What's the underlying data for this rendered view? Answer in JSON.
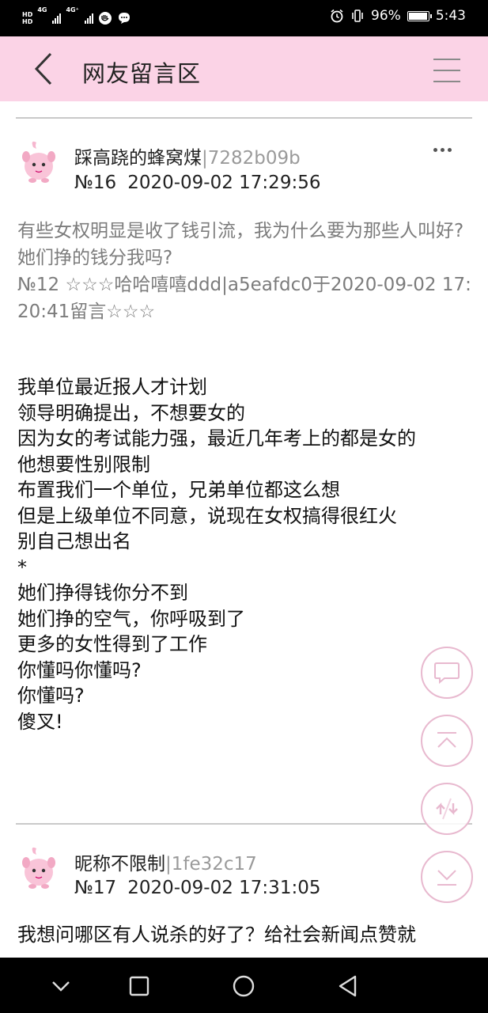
{
  "status_bar": {
    "hd1": "HD",
    "hd2": "HD",
    "network1": "4G",
    "network2": "4G⁺",
    "battery_percent": "96%",
    "battery_level": 0.96,
    "time": "5:43"
  },
  "header": {
    "title": "网友留言区"
  },
  "posts": [
    {
      "author": "踩高跷的蜂窝煤",
      "uid": "|7282b09b",
      "number": "№16",
      "datetime": "2020-09-02 17:29:56",
      "quote_text": "有些女权明显是收了钱引流，我为什么要为那些人叫好?她们挣的钱分我吗?",
      "quote_meta": "№12 ☆☆☆哈哈嘻嘻ddd|a5eafdc0于2020-09-02 17:20:41留言☆☆☆",
      "lines": [
        "我单位最近报人才计划",
        "领导明确提出，不想要女的",
        "因为女的考试能力强，最近几年考上的都是女的",
        "他想要性别限制",
        "布置我们一个单位，兄弟单位都这么想",
        "但是上级单位不同意，说现在女权搞得很红火",
        "别自己想出名",
        "*",
        "她们挣得钱你分不到",
        "她们挣的空气，你呼吸到了",
        "更多的女性得到了工作",
        "你懂吗你懂吗?",
        "你懂吗?",
        "傻叉!"
      ]
    },
    {
      "author": "昵称不限制",
      "uid": "|1fe32c17",
      "number": "№17",
      "datetime": "2020-09-02 17:31:05",
      "first_line": "我想问哪区有人说杀的好了？给社会新闻点赞就"
    }
  ],
  "icons": {
    "back": "back-arrow-icon",
    "menu": "hamburger-menu-icon",
    "more": "more-dots-icon",
    "comment": "comment-bubble-icon",
    "to_top": "scroll-to-top-icon",
    "refresh": "refresh-icon",
    "to_bottom": "scroll-to-bottom-icon"
  },
  "colors": {
    "header_bg": "#fbd3e6",
    "fab_border": "#e8b9cf",
    "uid_color": "#9a9a9a",
    "quote_color": "#7c7c7c"
  }
}
